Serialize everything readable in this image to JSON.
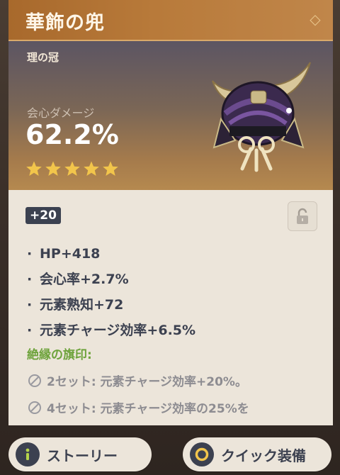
{
  "artifact": {
    "name": "華飾の兜",
    "slot": "理の冠",
    "main_stat_name": "会心ダメージ",
    "main_stat_value": "62.2%",
    "rarity_stars": 5,
    "level": "+20",
    "locked": false
  },
  "substats": [
    "HP+418",
    "会心率+2.7%",
    "元素熟知+72",
    "元素チャージ効率+6.5%"
  ],
  "set": {
    "name": "絶縁の旗印:",
    "bonuses": [
      "2セット: 元素チャージ効率+20%。",
      "4セット: 元素チャージ効率の25%を"
    ]
  },
  "buttons": {
    "story": "ストーリー",
    "quick_equip": "クイック装備"
  },
  "colors": {
    "title_bar": "#b87a3a",
    "set_name": "#6ea33c",
    "star": "#f2c54b",
    "level_badge": "#3b4150"
  },
  "icons": {
    "lock": "unlock-icon",
    "story": "info-icon",
    "quick_equip": "ring-icon",
    "set_bonus": "inactive-circle-icon"
  }
}
